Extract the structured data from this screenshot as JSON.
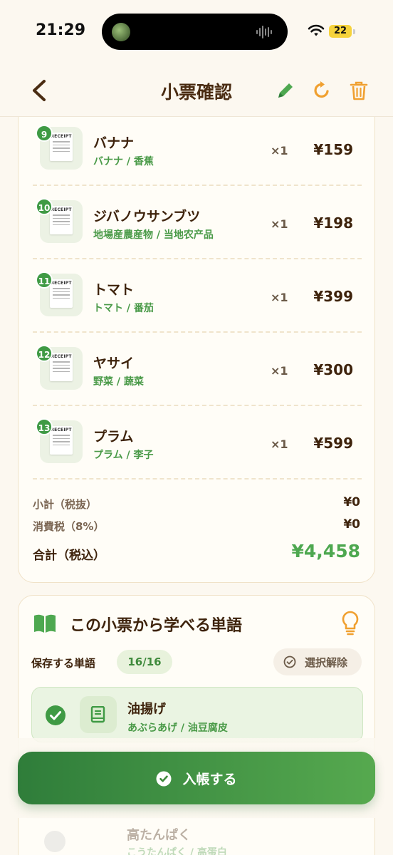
{
  "status_bar": {
    "time": "21:29",
    "battery": "22"
  },
  "header": {
    "title": "小票確認"
  },
  "receipt": {
    "items": [
      {
        "index": "9",
        "name": "バナナ",
        "sub": "バナナ / 香蕉",
        "qty": "×1",
        "price": "¥159"
      },
      {
        "index": "10",
        "name": "ジバノウサンブツ",
        "sub": "地場産農産物 / 当地农产品",
        "qty": "×1",
        "price": "¥198"
      },
      {
        "index": "11",
        "name": "トマト",
        "sub": "トマト / 番茄",
        "qty": "×1",
        "price": "¥399"
      },
      {
        "index": "12",
        "name": "ヤサイ",
        "sub": "野菜 / 蔬菜",
        "qty": "×1",
        "price": "¥300"
      },
      {
        "index": "13",
        "name": "プラム",
        "sub": "プラム / 李子",
        "qty": "×1",
        "price": "¥599"
      }
    ],
    "thumb_label": "RECEIPT",
    "subtotal_label": "小計（税抜）",
    "subtotal_value": "¥0",
    "tax_label": "消費税（8%）",
    "tax_value": "¥0",
    "total_label": "合計（税込）",
    "total_value": "¥4,458"
  },
  "vocab": {
    "title": "この小票から学べる単語",
    "save_label": "保存する単語",
    "count": "16/16",
    "deselect_label": "選択解除",
    "words": [
      {
        "word": "油揚げ",
        "reading": "あぶらあげ / 油豆腐皮"
      }
    ],
    "faded_word": {
      "word": "高たんぱく",
      "reading": "こうたんぱく / 高蛋白"
    }
  },
  "footer": {
    "submit_label": "入帳する"
  },
  "colors": {
    "accent_green": "#4ea850",
    "brown_text": "#3e230c",
    "orange": "#f0a030",
    "background": "#fcf8f0"
  }
}
